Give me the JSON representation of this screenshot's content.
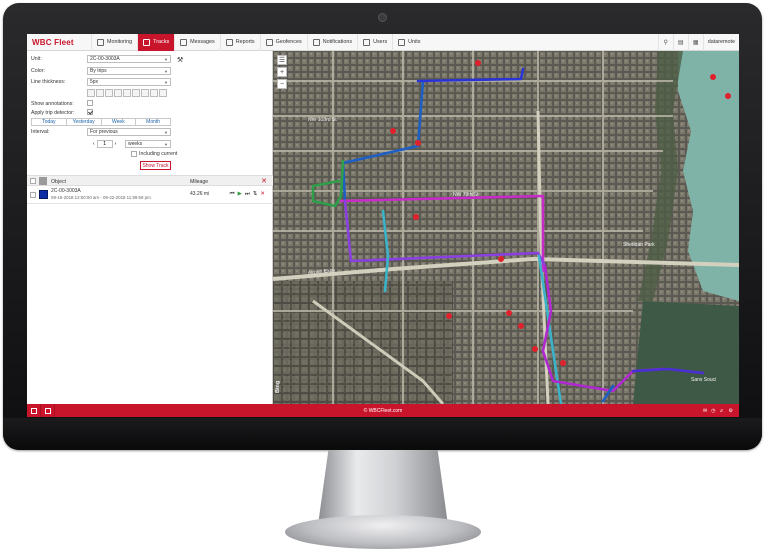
{
  "app": {
    "logo": "WBC Fleet",
    "copyright": "© WBCFleet.com"
  },
  "nav": {
    "tabs": [
      {
        "label": "Monitoring",
        "active": false
      },
      {
        "label": "Tracks",
        "active": true
      },
      {
        "label": "Messages",
        "active": false
      },
      {
        "label": "Reports",
        "active": false
      },
      {
        "label": "Geofences",
        "active": false
      },
      {
        "label": "Notifications",
        "active": false
      },
      {
        "label": "Users",
        "active": false
      },
      {
        "label": "Units",
        "active": false
      }
    ],
    "username": "dataremote"
  },
  "form": {
    "unit_label": "Unit:",
    "unit_value": "2C-00-3003A",
    "color_label": "Color:",
    "color_value": "By trips",
    "thickness_label": "Line thickness:",
    "thickness_value": "5px",
    "annotations_label": "Show annotations:",
    "trip_detector_label": "Apply trip detector:",
    "period_tabs": [
      "Today",
      "Yesterday",
      "Week",
      "Month"
    ],
    "interval_label": "Interval:",
    "interval_value": "For previous",
    "interval_count": "1",
    "interval_unit": "weeks",
    "including_current": "Including current",
    "show_track": "Show Track"
  },
  "table": {
    "col_object": "Object",
    "col_mileage": "Mileage",
    "rows": [
      {
        "name": "2C-00-3003A",
        "period": "09-16-2018 12:00:00 am - 09-22-2018 11:59:59 pm",
        "mileage": "43.26 mi",
        "color": "#0b2ea8"
      }
    ]
  },
  "map": {
    "labels": [
      "Airport Expy",
      "Bing",
      "NW 103rd St",
      "NW 79th St",
      "Sans Souci",
      "Sheridan Park"
    ]
  }
}
